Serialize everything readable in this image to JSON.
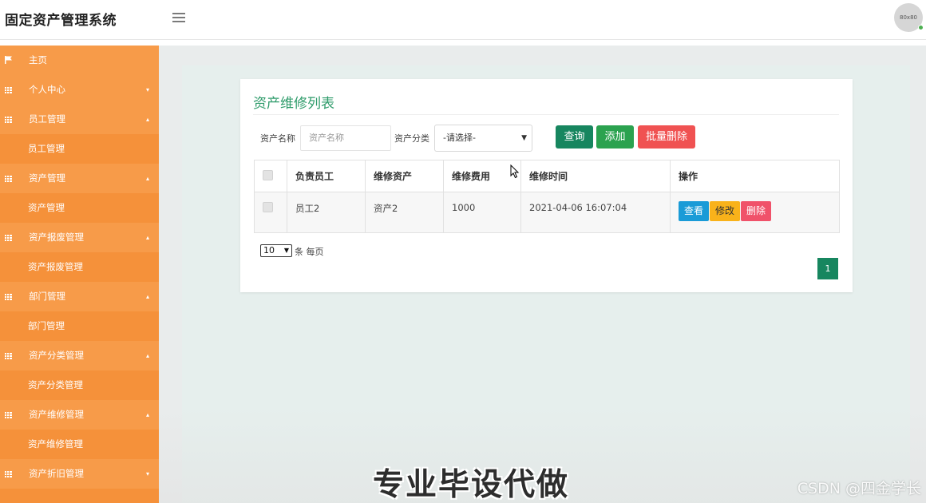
{
  "header": {
    "title": "固定资产管理系统",
    "avatar_text": "80x80"
  },
  "sidebar": {
    "items": [
      {
        "label": "主页",
        "kind": "home",
        "icon": "flag-icon"
      },
      {
        "label": "个人中心",
        "kind": "parent",
        "icon": "grid-icon",
        "arrow": "▾"
      },
      {
        "label": "员工管理",
        "kind": "parent",
        "icon": "grid-icon",
        "arrow": "▴"
      },
      {
        "label": "员工管理",
        "kind": "child"
      },
      {
        "label": "资产管理",
        "kind": "parent",
        "icon": "grid-icon",
        "arrow": "▴"
      },
      {
        "label": "资产管理",
        "kind": "child"
      },
      {
        "label": "资产报废管理",
        "kind": "parent",
        "icon": "grid-icon",
        "arrow": "▴"
      },
      {
        "label": "资产报废管理",
        "kind": "child"
      },
      {
        "label": "部门管理",
        "kind": "parent",
        "icon": "grid-icon",
        "arrow": "▴"
      },
      {
        "label": "部门管理",
        "kind": "child"
      },
      {
        "label": "资产分类管理",
        "kind": "parent",
        "icon": "grid-icon",
        "arrow": "▴"
      },
      {
        "label": "资产分类管理",
        "kind": "child"
      },
      {
        "label": "资产维修管理",
        "kind": "parent",
        "icon": "grid-icon",
        "arrow": "▴"
      },
      {
        "label": "资产维修管理",
        "kind": "child"
      },
      {
        "label": "资产折旧管理",
        "kind": "parent",
        "icon": "grid-icon",
        "arrow": "▾"
      }
    ]
  },
  "page": {
    "title": "资产维修列表",
    "search": {
      "name_label": "资产名称",
      "name_placeholder": "资产名称",
      "category_label": "资产分类",
      "category_selected": "-请选择-"
    },
    "buttons": {
      "query": "查询",
      "add": "添加",
      "batch_delete": "批量删除"
    },
    "table": {
      "headers": [
        "负责员工",
        "维修资产",
        "维修费用",
        "维修时间",
        "操作"
      ],
      "rows": [
        {
          "employee": "员工2",
          "asset": "资产2",
          "cost": "1000",
          "time": "2021-04-06 16:07:04"
        }
      ],
      "actions": {
        "view": "查看",
        "edit": "修改",
        "delete": "删除"
      }
    },
    "pagination": {
      "page_size": "10",
      "page_size_label": "条 每页",
      "current_page": "1"
    }
  },
  "overlay": {
    "caption": "专业毕设代做",
    "watermark": "CSDN @四金学长"
  },
  "colors": {
    "sidebar": "#f5913a",
    "title_green": "#2e9b6a",
    "query_button": "#17865f",
    "add_button": "#2ba24f",
    "delete_button": "#f05252"
  }
}
